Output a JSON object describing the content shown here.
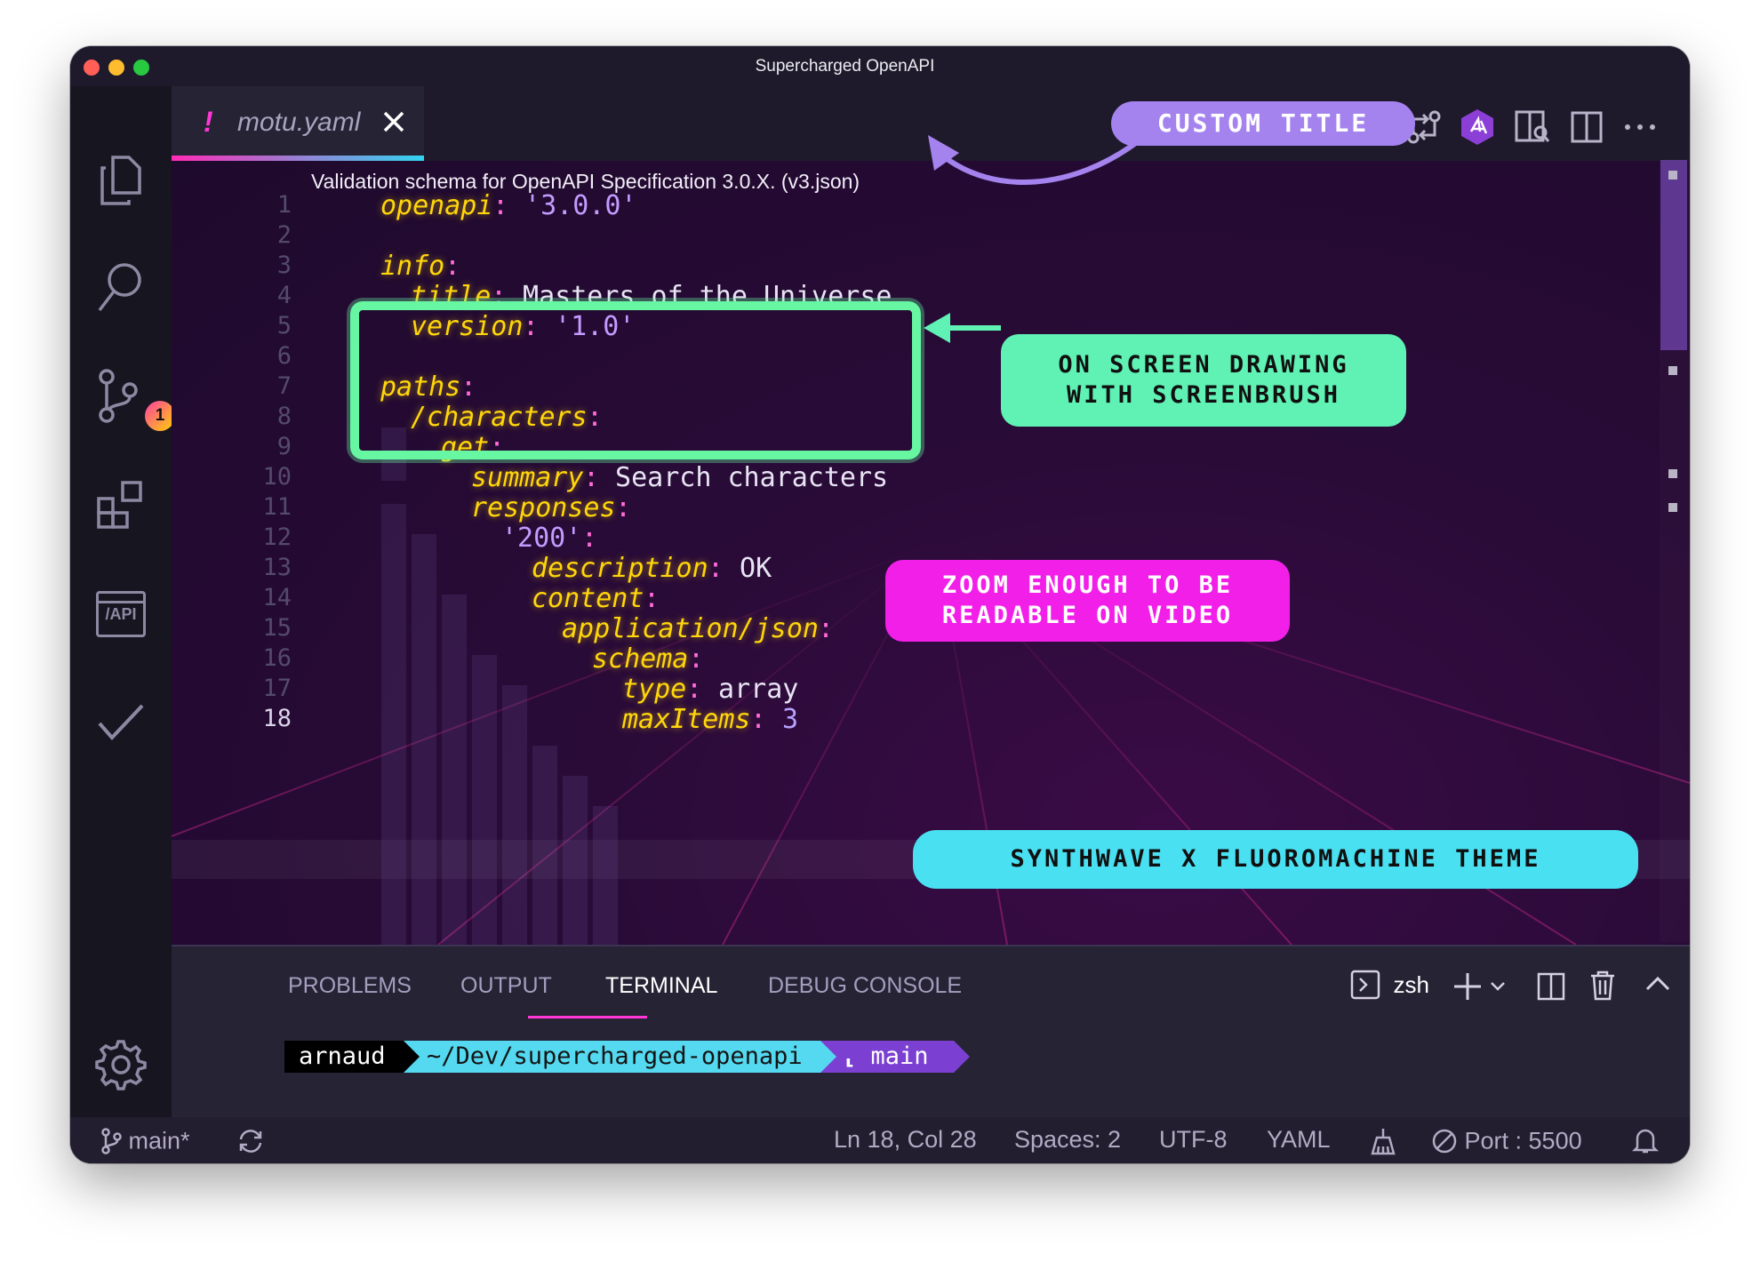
{
  "window": {
    "title": "Supercharged OpenAPI"
  },
  "activity_bar": {
    "items": [
      {
        "name": "explorer",
        "icon": "files-icon"
      },
      {
        "name": "search",
        "icon": "search-icon"
      },
      {
        "name": "source-control",
        "icon": "source-control-icon",
        "badge": "1"
      },
      {
        "name": "extensions",
        "icon": "extensions-icon"
      },
      {
        "name": "api",
        "icon": "api-icon",
        "label": "/API"
      },
      {
        "name": "testing",
        "icon": "check-icon"
      },
      {
        "name": "settings",
        "icon": "gear-icon"
      }
    ]
  },
  "tab": {
    "modified_marker": "!",
    "filename": "motu.yaml"
  },
  "editor": {
    "breadcrumb": "Validation schema for OpenAPI Specification 3.0.X. (v3.json)",
    "active_line": 18,
    "lines": [
      {
        "n": "1",
        "key": "openapi",
        "colon": ":",
        "value": " '3.0.0'",
        "vtype": "str"
      },
      {
        "n": "2",
        "key": "",
        "colon": "",
        "value": "",
        "vtype": "plain"
      },
      {
        "n": "3",
        "key": "info",
        "colon": ":",
        "value": "",
        "vtype": "plain"
      },
      {
        "n": "4",
        "key": "title",
        "colon": ":",
        "value": " Masters of the Universe",
        "vtype": "plain"
      },
      {
        "n": "5",
        "key": "version",
        "colon": ":",
        "value": " '1.0'",
        "vtype": "str"
      },
      {
        "n": "6",
        "key": "",
        "colon": "",
        "value": "",
        "vtype": "plain"
      },
      {
        "n": "7",
        "key": "paths",
        "colon": ":",
        "value": "",
        "vtype": "plain"
      },
      {
        "n": "8",
        "key": "/characters",
        "colon": ":",
        "value": "",
        "vtype": "plain"
      },
      {
        "n": "9",
        "key": "get",
        "colon": ":",
        "value": "",
        "vtype": "plain"
      },
      {
        "n": "10",
        "key": "summary",
        "colon": ":",
        "value": " Search characters",
        "vtype": "plain"
      },
      {
        "n": "11",
        "key": "responses",
        "colon": ":",
        "value": "",
        "vtype": "plain"
      },
      {
        "n": "12",
        "key": "",
        "colon": ":",
        "value": "'200'",
        "vtype": "str"
      },
      {
        "n": "13",
        "key": "description",
        "colon": ":",
        "value": " OK",
        "vtype": "plain"
      },
      {
        "n": "14",
        "key": "content",
        "colon": ":",
        "value": "",
        "vtype": "plain"
      },
      {
        "n": "15",
        "key": "application/json",
        "colon": ":",
        "value": "",
        "vtype": "plain"
      },
      {
        "n": "16",
        "key": "schema",
        "colon": ":",
        "value": "",
        "vtype": "plain"
      },
      {
        "n": "17",
        "key": "type",
        "colon": ":",
        "value": " array",
        "vtype": "plain"
      },
      {
        "n": "18",
        "key": "maxItems",
        "colon": ":",
        "value": " 3",
        "vtype": "num"
      }
    ]
  },
  "annotations": {
    "custom_title": "CUSTOM TITLE",
    "screen_drawing_1": "ON SCREEN DRAWING",
    "screen_drawing_2": "WITH SCREENBRUSH",
    "zoom_1": "ZOOM ENOUGH TO BE",
    "zoom_2": "READABLE ON VIDEO",
    "theme": "SYNTHWAVE X FLUOROMACHINE THEME"
  },
  "panel": {
    "tabs": [
      "PROBLEMS",
      "OUTPUT",
      "TERMINAL",
      "DEBUG CONSOLE"
    ],
    "active_tab": "TERMINAL",
    "shell": "zsh",
    "prompt": {
      "user": "arnaud",
      "path": "~/Dev/supercharged-openapi",
      "branch": "main"
    }
  },
  "status_bar": {
    "branch": "main*",
    "cursor": "Ln 18, Col 28",
    "spaces": "Spaces: 2",
    "encoding": "UTF-8",
    "language": "YAML",
    "port": "Port : 5500"
  },
  "colors": {
    "key": "#ffd60a",
    "string": "#c49bff",
    "accent_pink": "#ff37d7",
    "accent_cyan": "#49e0f2",
    "accent_green": "#5ff2b4",
    "annotation_purple": "#a583ef"
  }
}
